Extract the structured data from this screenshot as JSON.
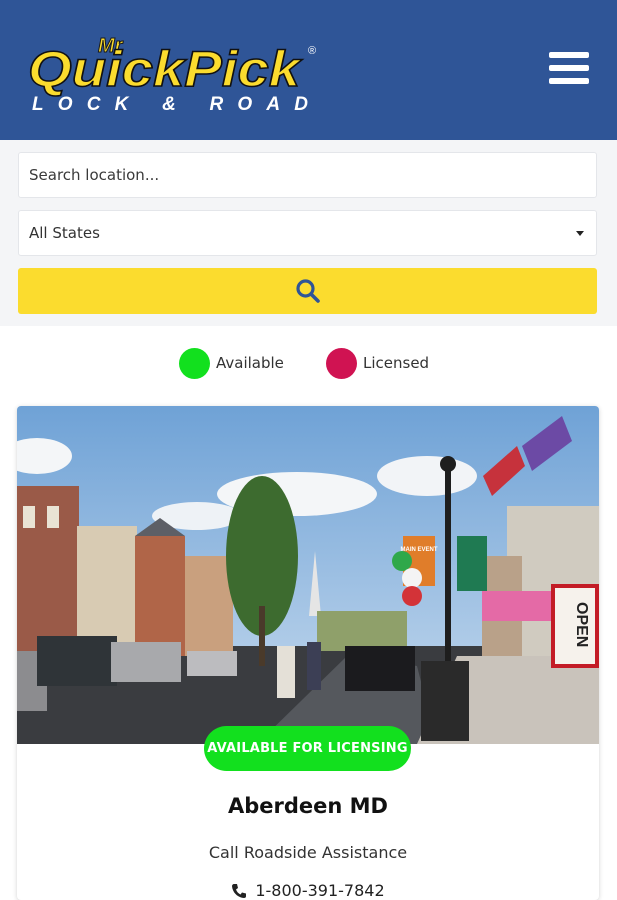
{
  "header": {
    "logo": {
      "top_text": "Mr",
      "main_text": "QuickPick",
      "sub_text": "LOCK & ROAD",
      "reg": "®"
    },
    "menu_icon": "hamburger-icon",
    "background": "#2f5597"
  },
  "search": {
    "placeholder": "Search location...",
    "state_selected": "All States",
    "button_icon": "search-icon",
    "button_color": "#fbdc2e"
  },
  "legend": [
    {
      "label": "Available",
      "color": "#12e01e"
    },
    {
      "label": "Licensed",
      "color": "#d01352"
    }
  ],
  "card": {
    "badge": "AVAILABLE FOR LICENSING",
    "city": "Aberdeen MD",
    "call_label": "Call Roadside Assistance",
    "phone_icon": "phone-icon",
    "phone": "1-800-391-7842",
    "banner_text": "MAIN EVENT",
    "sign_text": "OPEN"
  }
}
